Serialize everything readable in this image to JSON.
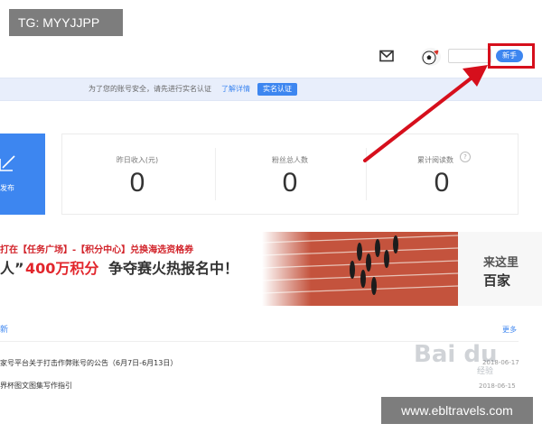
{
  "watermark": {
    "tag": "TG: MYYJJPP",
    "site": "www.ebltravels.com",
    "baidu": "Bai du",
    "jingyan": "经验"
  },
  "header": {
    "new_button": "新手"
  },
  "notice": {
    "text": "为了您的账号安全，请先进行实名认证",
    "link": "了解详情",
    "button": "实名认证"
  },
  "publish": {
    "label": "发布"
  },
  "stats": [
    {
      "label": "昨日收入(元)",
      "value": "0"
    },
    {
      "label": "粉丝总人数",
      "value": "0"
    },
    {
      "label": "累计阅读数",
      "value": "0"
    }
  ],
  "banner": {
    "line1": "打在【任务广场】-【积分中心】兑换海选资格券",
    "quote": "人”",
    "highlight": "400万积分",
    "rest": "争夺赛火热报名中！",
    "side_line1": "来这里",
    "side_line2": "百家"
  },
  "news": {
    "heading": "新",
    "more": "更多",
    "items": [
      {
        "title": "家号平台关于打击作弊账号的公告（6月7日-6月13日）",
        "date": "2018-06-17"
      },
      {
        "title": "界杯图文图集写作指引",
        "date": "2018-06-15"
      }
    ]
  },
  "colors": {
    "accent": "#3d86f0",
    "highlight": "#d60f1c",
    "notice_bg": "#e8eefb"
  }
}
